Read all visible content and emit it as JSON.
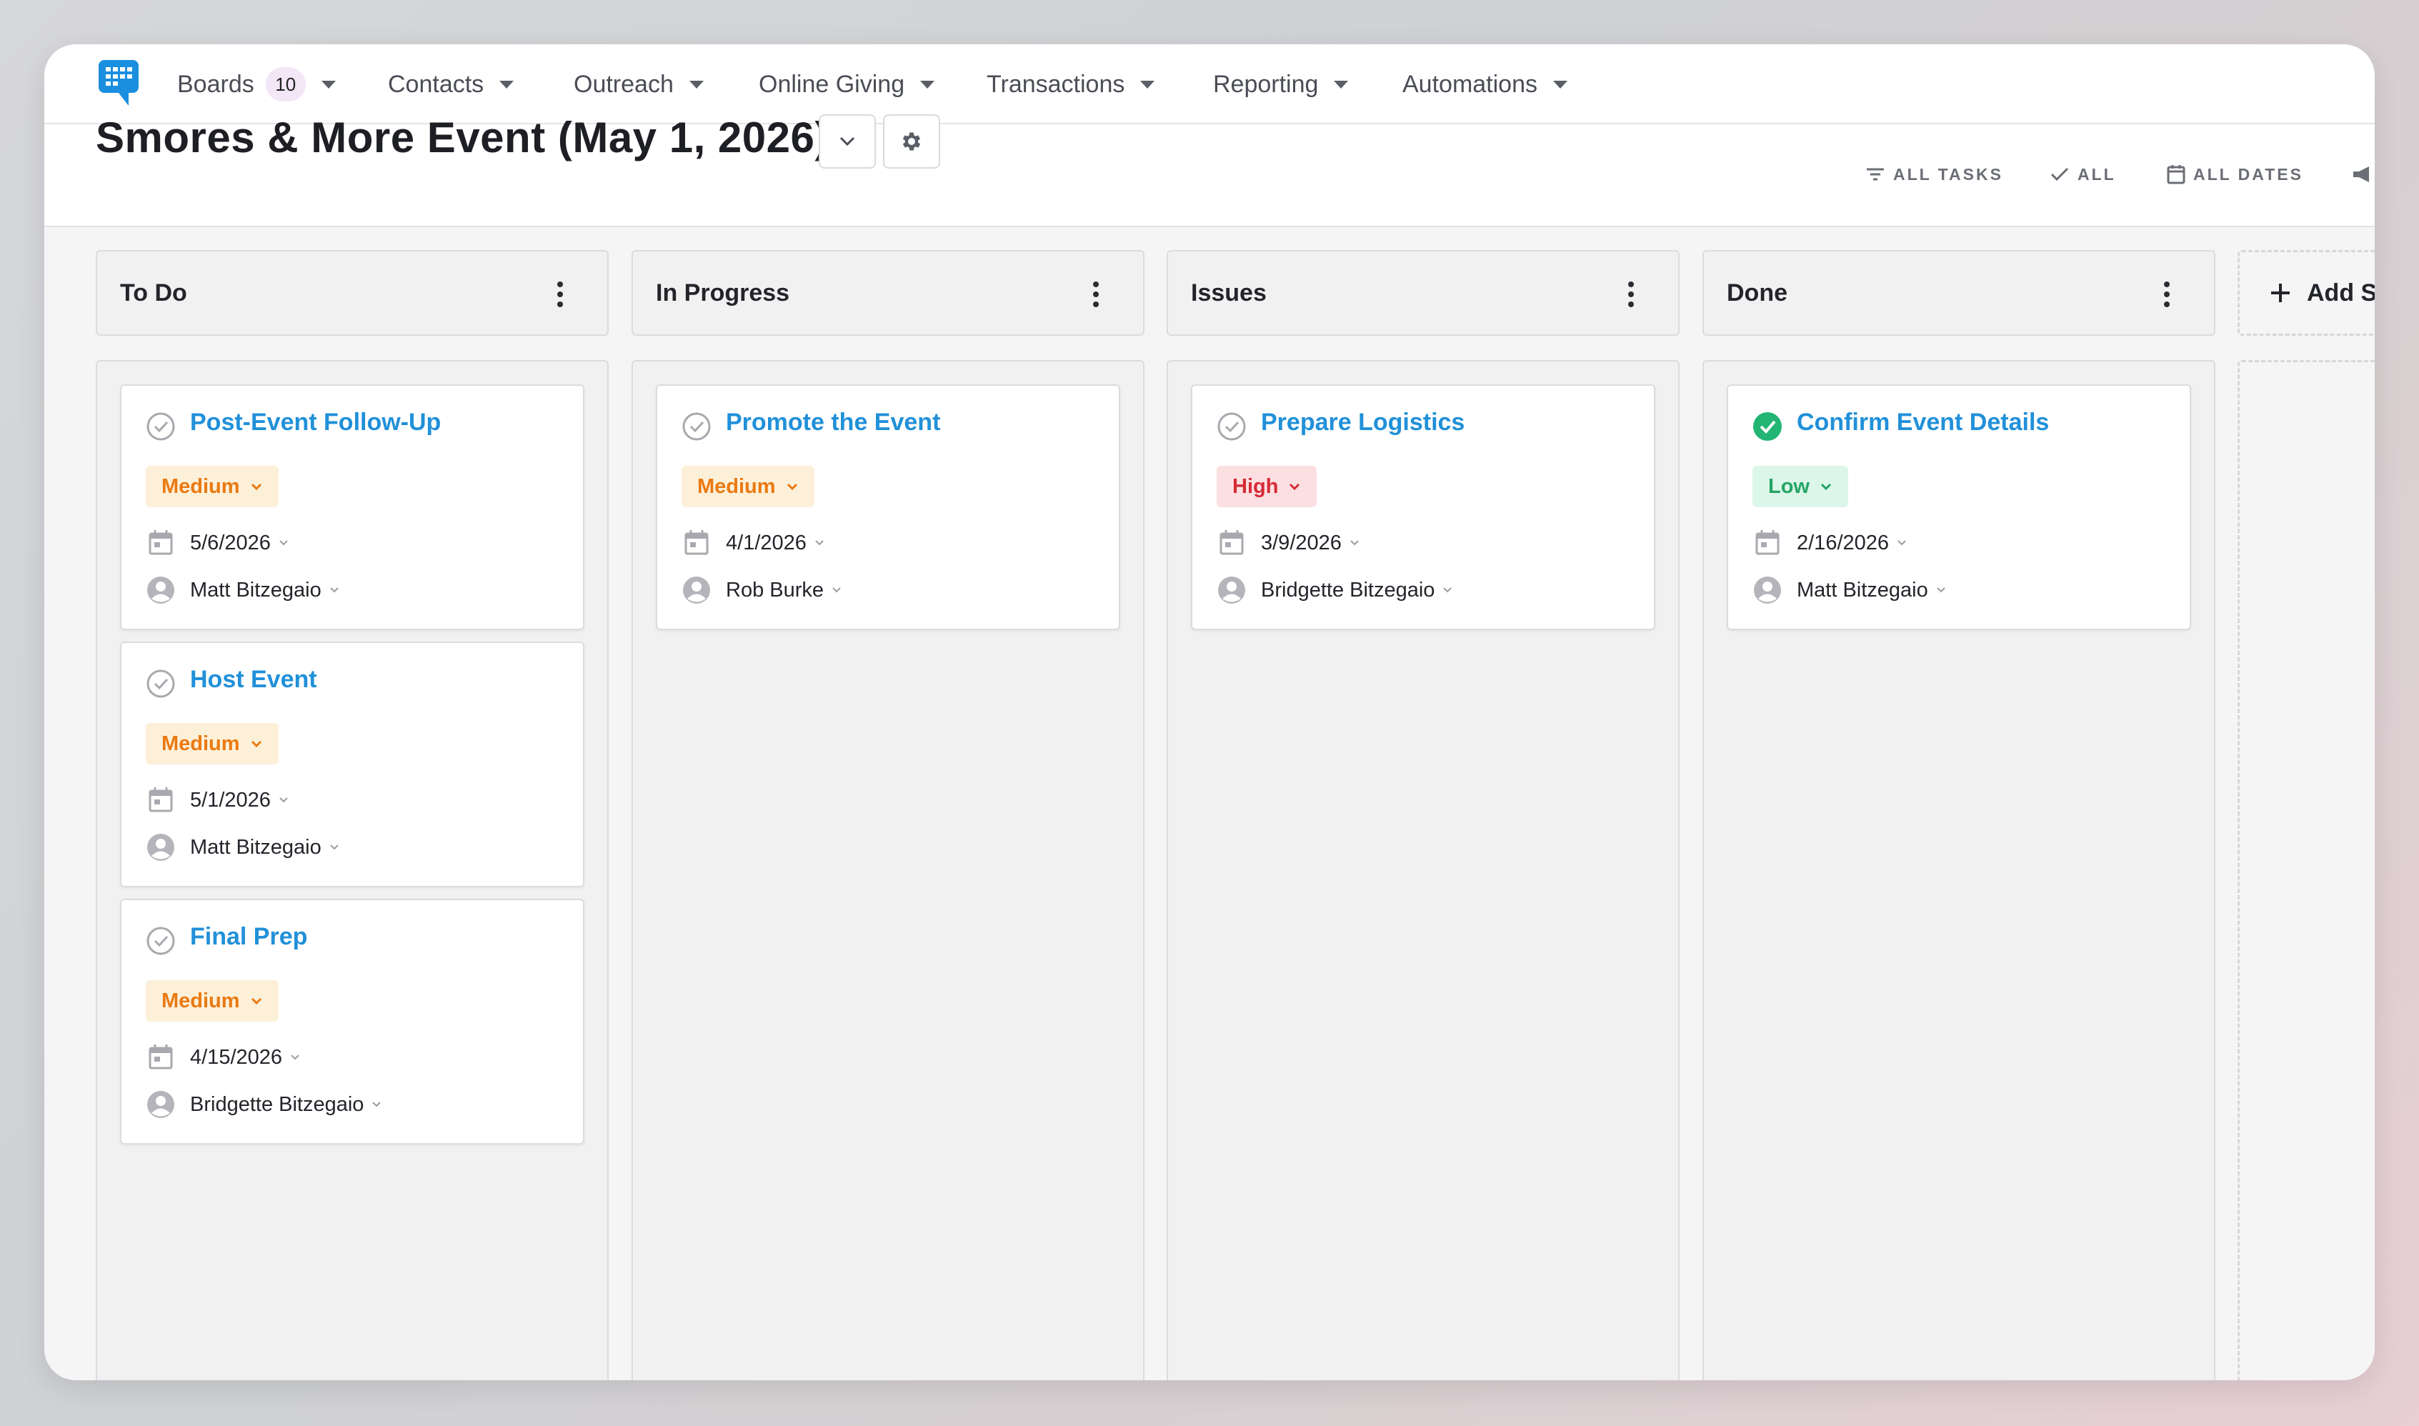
{
  "nav": {
    "items": [
      {
        "label": "Boards",
        "badge": "10"
      },
      {
        "label": "Contacts"
      },
      {
        "label": "Outreach"
      },
      {
        "label": "Online Giving"
      },
      {
        "label": "Transactions"
      },
      {
        "label": "Reporting"
      },
      {
        "label": "Automations"
      }
    ]
  },
  "header": {
    "title": "Smores & More Event (May 1, 2026)",
    "filters": {
      "tasks": "ALL TASKS",
      "status": "ALL",
      "dates": "ALL DATES"
    }
  },
  "columns": [
    {
      "title": "To Do",
      "cards": [
        {
          "title": "Post-Event Follow-Up",
          "priority": "Medium",
          "date": "5/6/2026",
          "assignee": "Matt Bitzegaio",
          "done": false
        },
        {
          "title": "Host Event",
          "priority": "Medium",
          "date": "5/1/2026",
          "assignee": "Matt Bitzegaio",
          "done": false
        },
        {
          "title": "Final Prep",
          "priority": "Medium",
          "date": "4/15/2026",
          "assignee": "Bridgette Bitzegaio",
          "done": false
        }
      ]
    },
    {
      "title": "In Progress",
      "cards": [
        {
          "title": "Promote the Event",
          "priority": "Medium",
          "date": "4/1/2026",
          "assignee": "Rob Burke",
          "done": false
        }
      ]
    },
    {
      "title": "Issues",
      "cards": [
        {
          "title": "Prepare Logistics",
          "priority": "High",
          "date": "3/9/2026",
          "assignee": "Bridgette Bitzegaio",
          "done": false
        }
      ]
    },
    {
      "title": "Done",
      "cards": [
        {
          "title": "Confirm Event Details",
          "priority": "Low",
          "date": "2/16/2026",
          "assignee": "Matt Bitzegaio",
          "done": true
        }
      ]
    }
  ],
  "add_stage_label": "Add S",
  "colors": {
    "accent": "#2190d9",
    "medium": "#ea7a12",
    "high": "#d62b36",
    "low": "#25a466",
    "done_check": "#22b573"
  }
}
